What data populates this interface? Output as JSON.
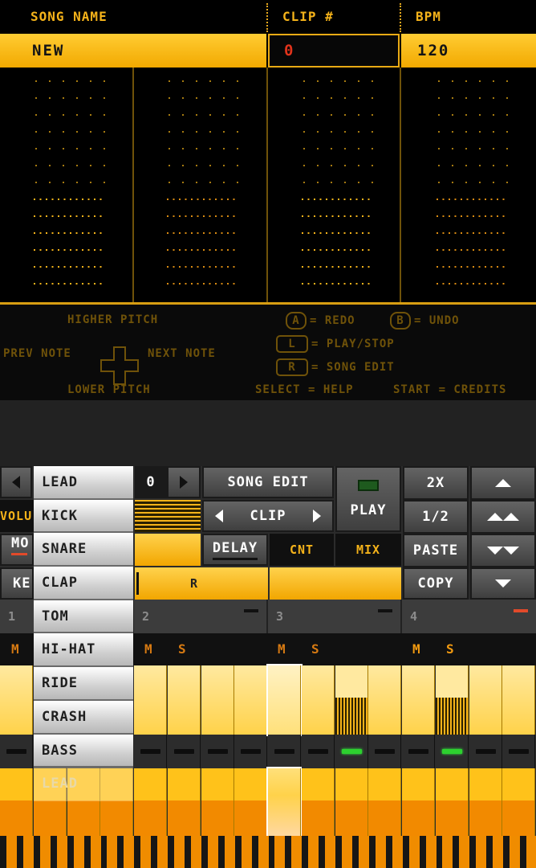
{
  "header": {
    "song_name_label": "SONG NAME",
    "clip_label": "CLIP #",
    "bpm_label": "BPM",
    "song_name": "NEW",
    "clip_number": "0",
    "bpm": "120"
  },
  "help": {
    "higher_pitch": "HIGHER PITCH",
    "lower_pitch": "LOWER PITCH",
    "prev_note": "PREV NOTE",
    "next_note": "NEXT NOTE",
    "btn_a": "A",
    "redo": "= REDO",
    "btn_b": "B",
    "undo": "= UNDO",
    "btn_l": "L",
    "play_stop": "= PLAY/STOP",
    "btn_r": "R",
    "song_edit": "= SONG EDIT",
    "select_help": "SELECT = HELP",
    "start_credits": "START = CREDITS"
  },
  "panel": {
    "instrument_selected": "LEAD",
    "clip_index": "0",
    "song_edit": "SONG EDIT",
    "clip": "CLIP",
    "play": "PLAY",
    "delay": "DELAY",
    "cnt": "CNT",
    "mix": "MIX",
    "x2": "2X",
    "half": "1/2",
    "paste": "PASTE",
    "copy": "COPY",
    "vol_partial": "VOLU",
    "mo_partial": "MO",
    "ke_partial": "KE",
    "r_label": "R"
  },
  "menu": {
    "items": [
      "KICK",
      "SNARE",
      "CLAP",
      "TOM",
      "HI-HAT",
      "RIDE",
      "CRASH",
      "BASS",
      "LEAD"
    ]
  },
  "tracks": [
    {
      "num": "1",
      "m": "M",
      "s": ""
    },
    {
      "num": "2",
      "m": "M",
      "s": "S"
    },
    {
      "num": "3",
      "m": "M",
      "s": "S"
    },
    {
      "num": "4",
      "m": "M",
      "s": "S"
    }
  ],
  "colors": {
    "accent": "#f5b31a",
    "background": "#000000",
    "led_on": "#2dd12f",
    "clip_red": "#e1331b"
  }
}
